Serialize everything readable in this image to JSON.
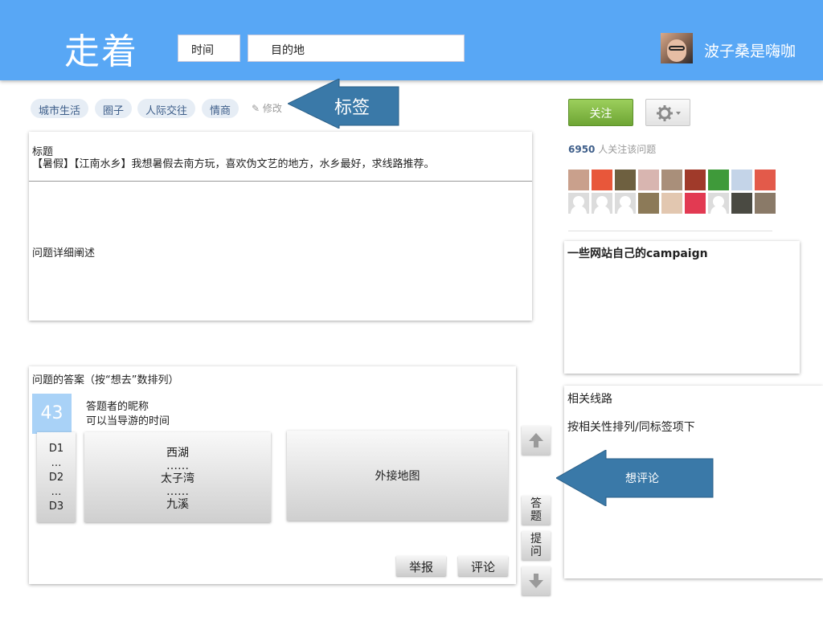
{
  "header": {
    "logo": "走着",
    "search_time": "时间",
    "search_destination": "目的地",
    "username": "波子桑是嗨咖",
    "bg_color": "#58a7f5"
  },
  "tags": {
    "items": [
      "城市生活",
      "圈子",
      "人际交往",
      "情商"
    ],
    "edit_label": "✎ 修改",
    "annotation": "标签"
  },
  "question": {
    "title_label": "标题",
    "title_text": "【暑假】【江南水乡】我想暑假去南方玩，喜欢伪文艺的地方，水乡最好，求线路推荐。",
    "detail_label": "问题详细阐述"
  },
  "answers": {
    "header": "问题的答案（按“想去”数排列）",
    "vote_count": "43",
    "answerer_name": "答题者的昵称",
    "answerer_availability": "可以当导游的时间",
    "days": [
      "D1",
      "…",
      "D2",
      "…",
      "D3"
    ],
    "route": [
      "西湖",
      "……",
      "太子湾",
      "……",
      "九溪"
    ],
    "map_label": "外接地图",
    "report_label": "举报",
    "comment_label": "评论"
  },
  "side_controls": {
    "up_icon": "arrow-up-icon",
    "answer_label": [
      "答",
      "题"
    ],
    "ask_label": [
      "提",
      "问"
    ],
    "down_icon": "arrow-down-icon"
  },
  "sidebar": {
    "follow_label": "关注",
    "followers_count": "6950",
    "followers_text": "人关注该问题",
    "follower_avatars": [
      {
        "color": "#c9a08c"
      },
      {
        "color": "#e8573a"
      },
      {
        "color": "#6e6040"
      },
      {
        "color": "#d8b5b0"
      },
      {
        "color": "#a98f7a"
      },
      {
        "color": "#a03a2a"
      },
      {
        "color": "#3f9a3a"
      },
      {
        "color": "#c4d4e8"
      },
      {
        "color": "#e35a4a"
      },
      {
        "color": "#dcdcdc"
      },
      {
        "color": "#dcdcdc"
      },
      {
        "color": "#dcdcdc"
      },
      {
        "color": "#8c7a58"
      },
      {
        "color": "#e2c7b0"
      },
      {
        "color": "#e23a52"
      },
      {
        "color": "#dcdcdc"
      },
      {
        "color": "#4a4a42"
      },
      {
        "color": "#8a7a68"
      }
    ],
    "campaign_title": "一些网站自己的campaign",
    "related_title": "相关线路",
    "related_sort": "按相关性排列/同标签项下",
    "comment_annotation": "想评论"
  }
}
